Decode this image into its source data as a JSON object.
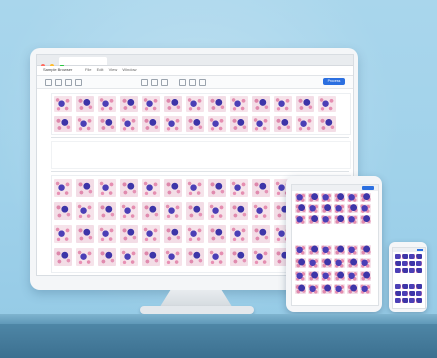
{
  "app": {
    "title": "Sample Browser",
    "menu": [
      "File",
      "Edit",
      "View",
      "Window"
    ],
    "primary_button": "Process"
  },
  "colors": {
    "background": "#a9d6ec",
    "desk": "#4e86a6",
    "accent": "#2b6fe0",
    "cell_nucleus": "#4b3fb6",
    "cell_stain": "#e28fb0"
  },
  "icons": [
    "thumbnail-grid-icon",
    "tool-icon"
  ]
}
